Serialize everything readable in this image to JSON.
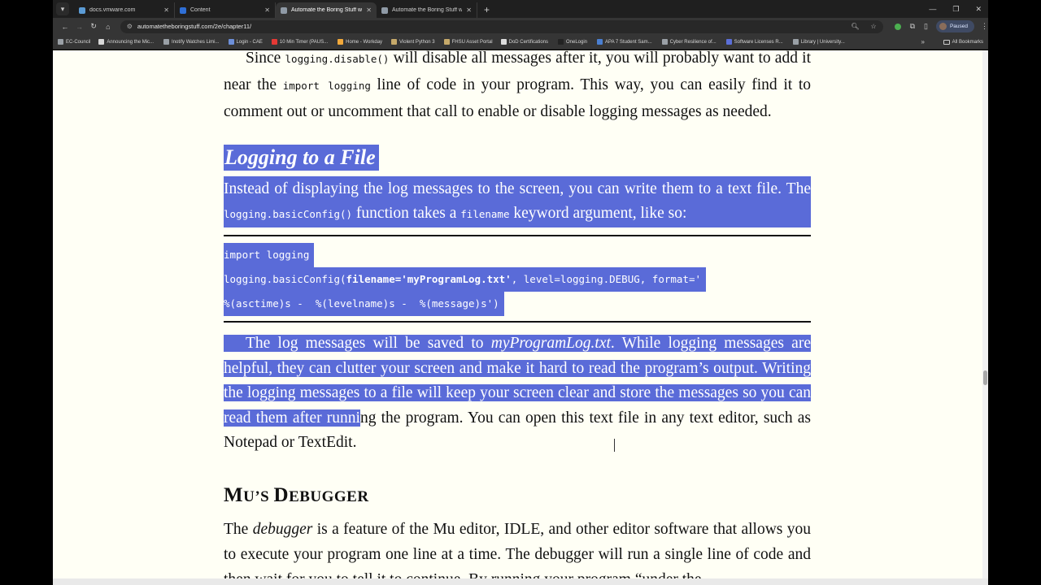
{
  "browser": {
    "tabs": [
      {
        "label": "docs.vmware.com",
        "fav": "#5b9bd5",
        "active": false
      },
      {
        "label": "Content",
        "fav": "#2f6fd6",
        "active": false
      },
      {
        "label": "Automate the Boring Stuff with",
        "fav": "#8f9aa6",
        "active": true
      },
      {
        "label": "Automate the Boring Stuff with",
        "fav": "#8f9aa6",
        "active": false
      }
    ],
    "url": "automatetheboringstuff.com/2e/chapter11/",
    "profile_label": "Paused",
    "bookmarks": [
      {
        "label": "EC-Council",
        "color": "#9aa0a6"
      },
      {
        "label": "Announcing the Mic...",
        "color": "#d7d7d7"
      },
      {
        "label": "Inotify Watches Limi...",
        "color": "#9aa0a6"
      },
      {
        "label": "Login - CAE",
        "color": "#6d8fd8"
      },
      {
        "label": "10 Min Timer (PAUS...",
        "color": "#e53935"
      },
      {
        "label": "Home - Workday",
        "color": "#f2a93b"
      },
      {
        "label": "Violent Python 3",
        "color": "#c6a96a"
      },
      {
        "label": "FHSU Asset Portal",
        "color": "#c6a96a"
      },
      {
        "label": "DoD Certifications",
        "color": "#dddddd"
      },
      {
        "label": "OneLogin",
        "color": "#222222"
      },
      {
        "label": "APA 7 Student Sam...",
        "color": "#4a7fd1"
      },
      {
        "label": "Cyber Resilience of...",
        "color": "#9aa0a6"
      },
      {
        "label": "Software Licenses R...",
        "color": "#5b6fd8"
      },
      {
        "label": "Library | University...",
        "color": "#9aa0a6"
      }
    ],
    "all_bookmarks": "All Bookmarks"
  },
  "page": {
    "p1": {
      "t1": "Since ",
      "c1": "logging.disable()",
      "t2": " will disable all messages after it, you will probably want to add it near the ",
      "c2": "import logging",
      "t3": " line of code in your program. This way, you can easily find it to comment out or uncomment that call to enable or disable logging messages as needed."
    },
    "heading1": "Logging to a File",
    "p2": {
      "t1": "Instead of displaying the log messages to the screen, you can write them to a text file. The ",
      "c1": "logging.basicConfig()",
      "t2": " function takes a ",
      "c2": "filename",
      "t3": " keyword argument, like so:"
    },
    "code": {
      "line1": "import logging",
      "line2a": "logging.basicConfig(",
      "line2b": "filename='myProgramLog.txt'",
      "line2c": ", level=logging.DEBUG, format='",
      "line3": "%(asctime)s -  %(levelname)s -  %(message)s')"
    },
    "p3": {
      "t1": "The log messages will be saved to ",
      "em1": "myProgramLog.txt",
      "t2": ". While logging messages are helpful, they can clutter your screen and make it hard to read the program’s output. Writing the logging messages to a file will keep your screen clear and store the messages so you can read them after runni",
      "t3": "ng the program. You can open this text file in any text editor, such as Notepad or TextEdit."
    },
    "heading2": {
      "a": "M",
      "b": "U",
      "c": "’S ",
      "d": "D",
      "e": "EBUGGER"
    },
    "p4": {
      "t1": "The ",
      "em1": "debugger",
      "t2": " is a feature of the Mu editor, IDLE, and other editor software that allows you to execute your program one line at a time. The debugger will run a single line of code and then wait for you to tell it to continue. By running your program “under the"
    }
  }
}
